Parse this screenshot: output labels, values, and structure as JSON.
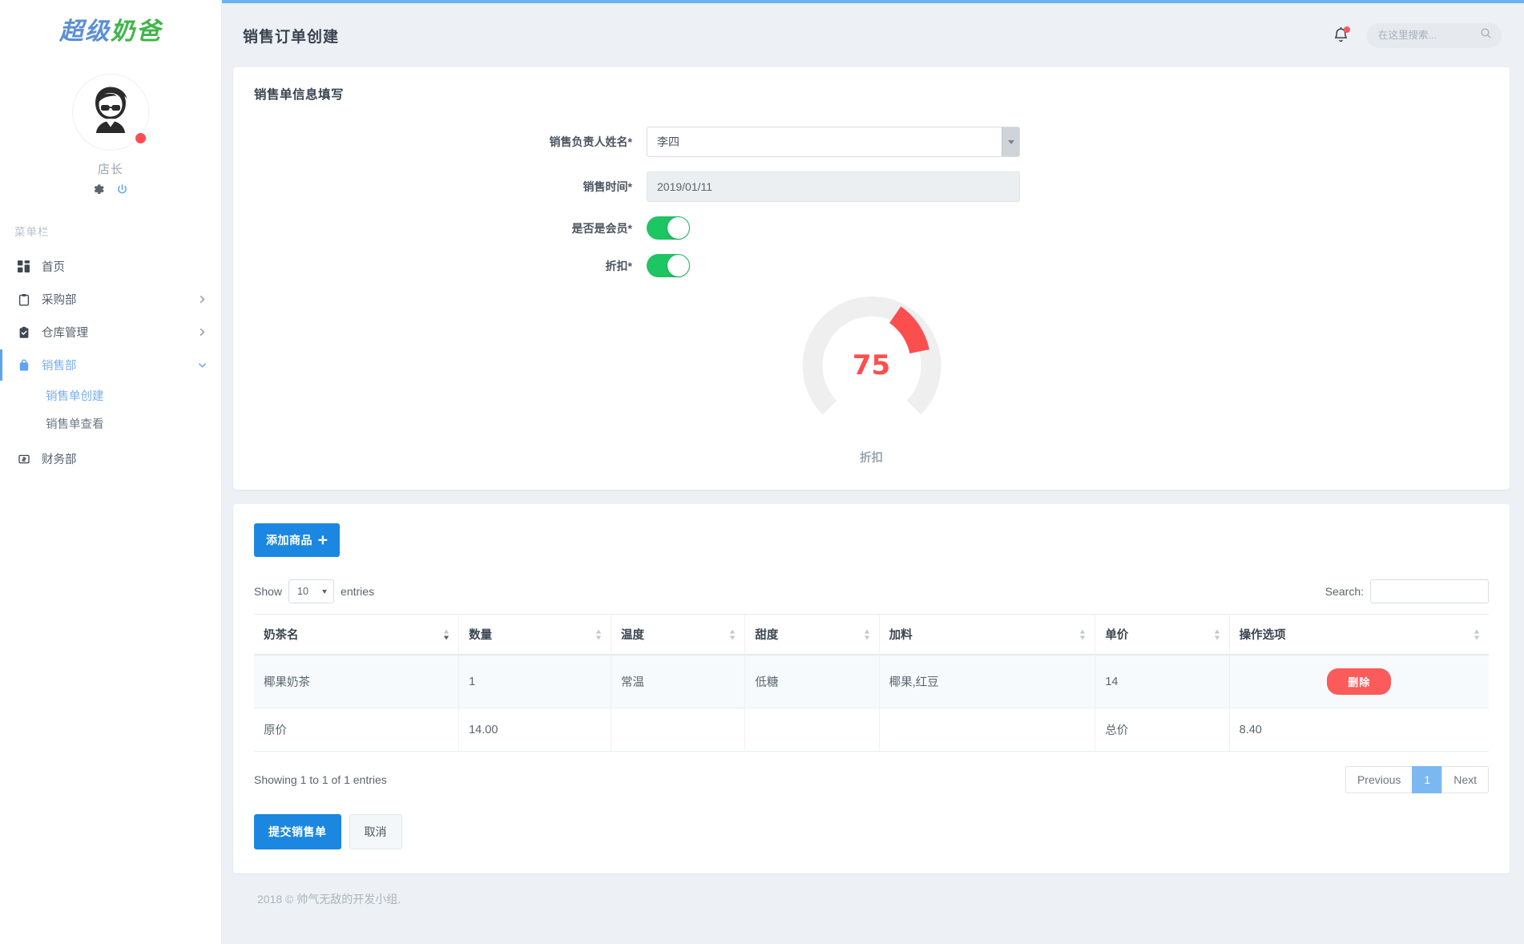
{
  "brand": {
    "part1": "超级",
    "part2": "奶爸"
  },
  "profile": {
    "name": "店长",
    "gear_icon": "gear-icon",
    "power_icon": "power-icon"
  },
  "sidebar": {
    "menu_heading": "菜单栏",
    "items": [
      {
        "label": "首页",
        "icon": "dashboard-icon",
        "has_caret": false,
        "active": false
      },
      {
        "label": "采购部",
        "icon": "clipboard-icon",
        "has_caret": true,
        "active": false
      },
      {
        "label": "仓库管理",
        "icon": "clipboard-check-icon",
        "has_caret": true,
        "active": false
      },
      {
        "label": "销售部",
        "icon": "briefcase-icon",
        "has_caret": true,
        "active": true
      },
      {
        "label": "财务部",
        "icon": "money-icon",
        "has_caret": false,
        "active": false
      }
    ],
    "submenu": [
      {
        "label": "销售单创建",
        "active": true
      },
      {
        "label": "销售单查看",
        "active": false
      }
    ]
  },
  "header": {
    "title": "销售订单创建",
    "bell_icon": "bell-icon",
    "search_placeholder": "在这里搜索...",
    "search_value": "",
    "search_icon": "search-icon"
  },
  "form": {
    "card_title": "销售单信息填写",
    "fields": [
      {
        "label": "销售负责人姓名*",
        "type": "select",
        "value": "李四"
      },
      {
        "label": "销售时间*",
        "type": "date",
        "value": "2019/01/11"
      },
      {
        "label": "是否是会员*",
        "type": "toggle",
        "value": "on"
      },
      {
        "label": "折扣*",
        "type": "toggle",
        "value": "on"
      }
    ],
    "gauge": {
      "value": "75",
      "label": "折扣",
      "max": 100,
      "arc_color": "#fb4f4f",
      "track_color": "#efefef"
    }
  },
  "table_card": {
    "add_button": "添加商品",
    "add_button_icon": "plus-icon",
    "length_label_before": "Show",
    "length_label_after": "entries",
    "length_value": "10",
    "search_label": "Search:",
    "search_value": "",
    "columns": [
      "奶茶名",
      "数量",
      "温度",
      "甜度",
      "加料",
      "单价",
      "操作选项"
    ],
    "rows": [
      {
        "cells": [
          "椰果奶茶",
          "1",
          "常温",
          "低糖",
          "椰果,红豆",
          "14",
          ""
        ],
        "action_label": "删除",
        "has_action": true
      },
      {
        "cells": [
          "原价",
          "14.00",
          "",
          "",
          "",
          "总价",
          "8.40"
        ],
        "has_action": false
      }
    ],
    "info": "Showing 1 to 1 of 1 entries",
    "pagination": {
      "previous": "Previous",
      "pages": [
        "1"
      ],
      "next": "Next",
      "current": "1"
    },
    "submit_label": "提交销售单",
    "cancel_label": "取消"
  },
  "footer": {
    "text": "2018 © 帅气无敌的开发小组."
  },
  "colors": {
    "accent_blue": "#1b87e0",
    "light_blue": "#7bb8f2",
    "toggle_green": "#1ec563",
    "danger_red": "#fb5b5b",
    "gauge_red": "#fb4f4f"
  }
}
